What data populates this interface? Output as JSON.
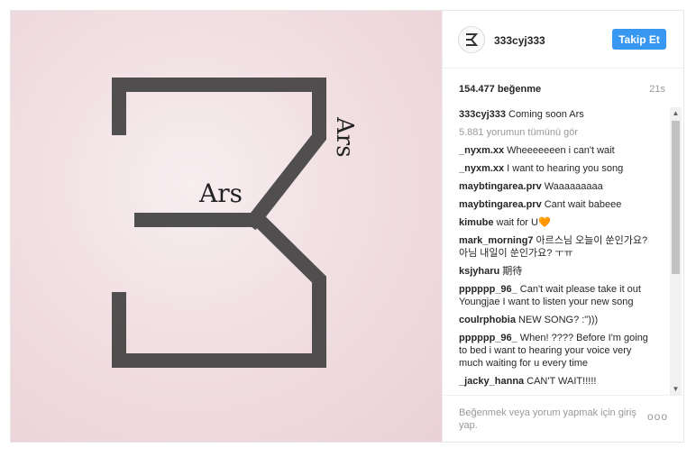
{
  "post": {
    "username": "333cyj333",
    "follow_label": "Takip Et",
    "likes": "154.477 beğenme",
    "time": "21s",
    "image_text_left": "Ars",
    "image_text_right": "Ars"
  },
  "caption": {
    "user": "333cyj333",
    "text": "Coming soon Ars"
  },
  "view_all": "5.881 yorumun tümünü gör",
  "comments": [
    {
      "user": "_nyxm.xx",
      "text": "Wheeeeeeen i can't wait"
    },
    {
      "user": "_nyxm.xx",
      "text": "I want to hearing you song"
    },
    {
      "user": "maybtingarea.prv",
      "text": "Waaaaaaaaa"
    },
    {
      "user": "maybtingarea.prv",
      "text": "Cant wait babeee"
    },
    {
      "user": "kimube",
      "text": "wait for U🧡"
    },
    {
      "user": "mark_morning7",
      "text": "아르스님 오늘이 쑨인가요? 아님 내일이 쑨인가요? ㅜㅠ"
    },
    {
      "user": "ksjyharu",
      "text": "期待"
    },
    {
      "user": "pppppp_96_",
      "text": "Can't wait please take it out Youngjae I want to listen your new song"
    },
    {
      "user": "coulrphobia",
      "text": "NEW SONG? :\")))"
    },
    {
      "user": "pppppp_96_",
      "text": "When! ???? Before I'm going to bed i want to hearing your voice very much waiting for u every time"
    },
    {
      "user": "_jacky_hanna",
      "text": "CAN'T WAIT!!!!!"
    }
  ],
  "footer": {
    "placeholder": "Beğenmek veya yorum yapmak için giriş yap.",
    "more": "ooo"
  },
  "icons": {
    "avatar": "logo-3-icon",
    "scroll_up": "triangle-up-icon",
    "scroll_down": "triangle-down-icon"
  }
}
